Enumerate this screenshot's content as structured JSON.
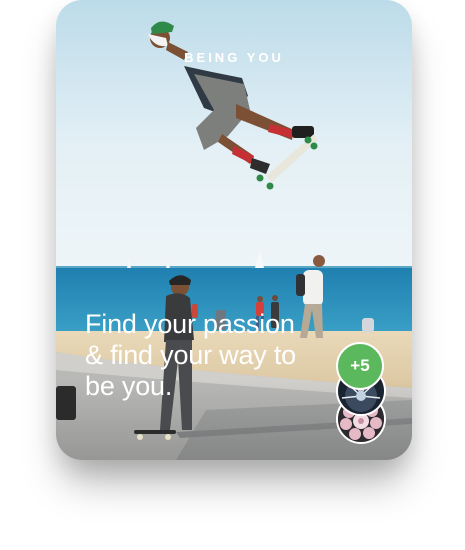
{
  "card": {
    "kicker": "BEING YOU",
    "headline": "Find your passion & find your way to be you.",
    "more_count": "+5"
  },
  "icons": {
    "avatar_1": "urchin-avatar",
    "avatar_2": "flower-avatar"
  },
  "colors": {
    "badge": "#5cb85c",
    "sky": "#dfedf4",
    "sea": "#2a8bb5",
    "sand": "#e2d1b0",
    "text": "#ffffff"
  }
}
